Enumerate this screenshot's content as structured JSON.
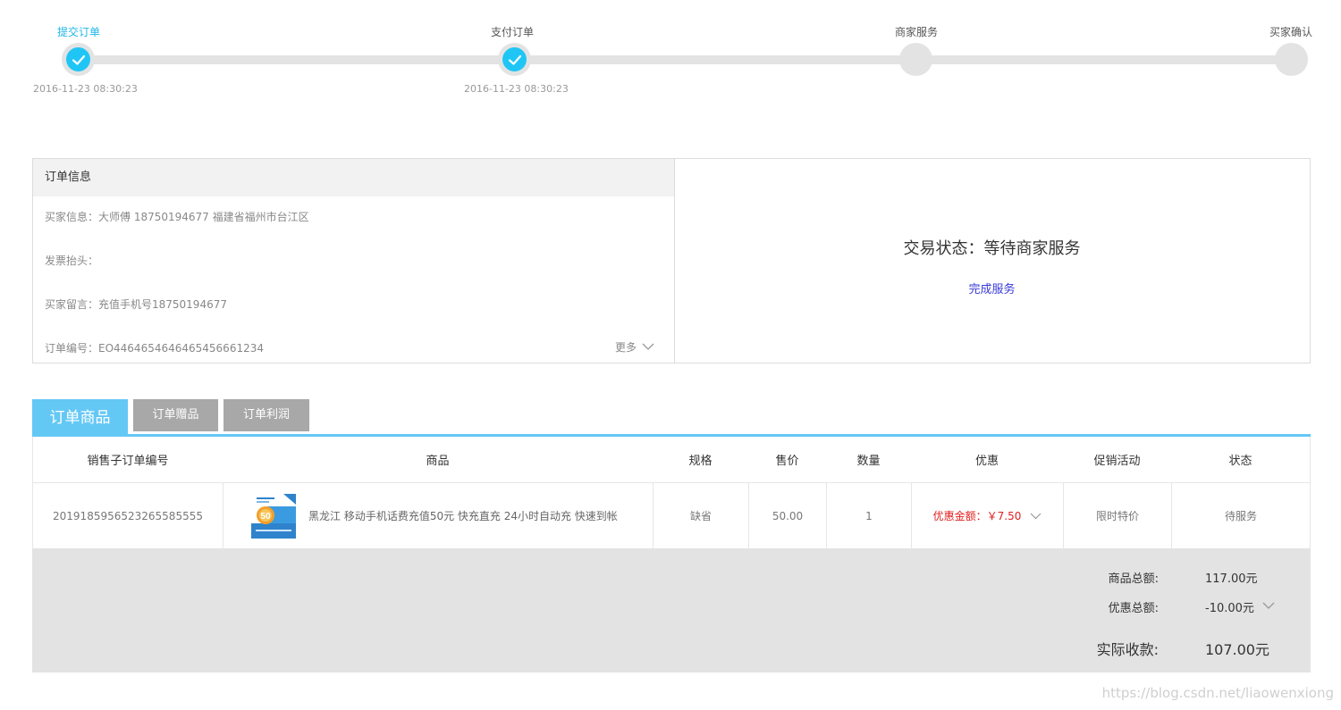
{
  "steps": [
    {
      "label": "提交订单",
      "time": "2016-11-23 08:30:23",
      "done": true
    },
    {
      "label": "支付订单",
      "time": "2016-11-23 08:30:23",
      "done": true
    },
    {
      "label": "商家服务",
      "time": "",
      "done": false
    },
    {
      "label": "买家确认",
      "time": "",
      "done": false
    }
  ],
  "order_info": {
    "title": "订单信息",
    "buyer": "买家信息：大师傅  18750194677  福建省福州市台江区",
    "invoice": "发票抬头：",
    "message": "买家留言：充值手机号18750194677",
    "order_no": "订单编号：EO4464654646465456661234",
    "more": "更多"
  },
  "status": {
    "text": "交易状态：等待商家服务",
    "action": "完成服务"
  },
  "tabs": [
    "订单商品",
    "订单赠品",
    "订单利润"
  ],
  "table": {
    "headers": [
      "销售子订单编号",
      "商品",
      "规格",
      "售价",
      "数量",
      "优惠",
      "促销活动",
      "状态"
    ],
    "row": {
      "sub_order_no": "2019185956523265585555",
      "product": "黑龙江 移动手机话费充值50元 快充直充 24小时自动充 快速到帐",
      "spec": "缺省",
      "price": "50.00",
      "qty": "1",
      "discount": "优惠金额：￥7.50",
      "promo": "限时特价",
      "state": "待服务"
    }
  },
  "totals": {
    "goods_label": "商品总额:",
    "goods_value": "117.00元",
    "discount_label": "优惠总额:",
    "discount_value": "-10.00元",
    "actual_label": "实际收款:",
    "actual_value": "107.00元"
  },
  "watermark": "https://blog.csdn.net/liaowenxiong",
  "colors": {
    "accent": "#1fc6f5",
    "tab_active": "#64c8f5",
    "tab_inactive": "#a8a8a8",
    "discount": "#e02020",
    "link": "#3a3ad8"
  }
}
